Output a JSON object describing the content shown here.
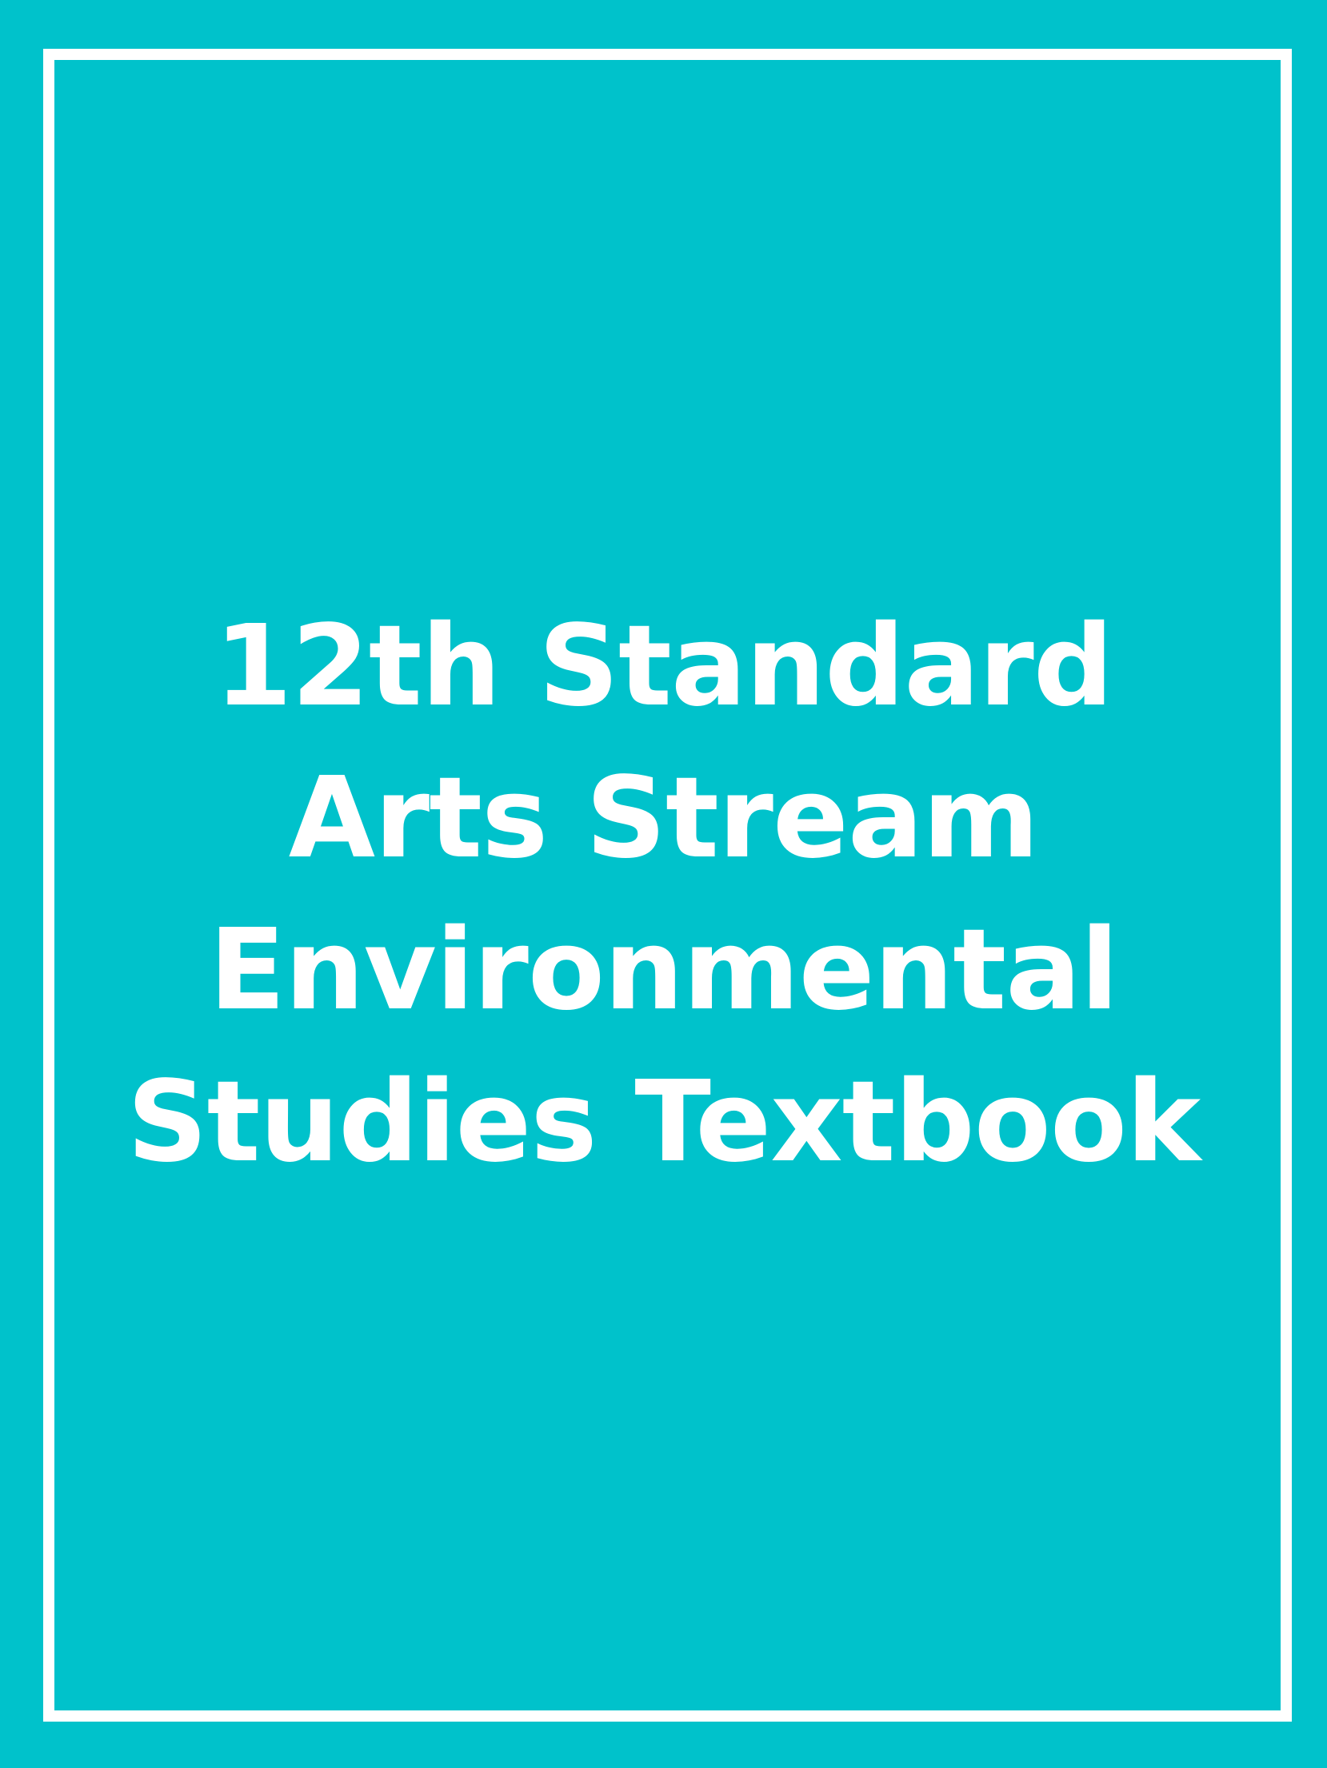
{
  "cover": {
    "background_color": "#00C2CB",
    "frame_color": "#FFFFFF",
    "text_color": "#FFFFFF",
    "title_lines": [
      "12th Standard",
      "Arts Stream",
      "Environmental",
      "Studies Textbook"
    ]
  }
}
